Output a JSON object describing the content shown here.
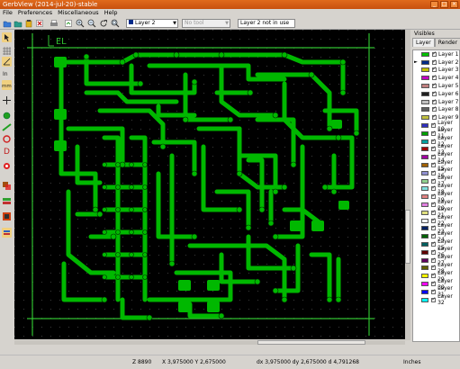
{
  "window": {
    "title": "GerbView (2014-jul-20)-stable"
  },
  "menu": [
    "File",
    "Preferences",
    "Miscellaneous",
    "Help"
  ],
  "toolbar": {
    "icons": [
      "open-gerber-icon",
      "open-drill-icon",
      "open-zip-icon",
      "erase-all-icon",
      "print-icon",
      "zoom-in-icon",
      "zoom-out-icon",
      "zoom-redraw-icon",
      "zoom-fit-icon"
    ],
    "layer_combo": "Layer 2",
    "tool_combo": "No tool",
    "layer_status": "Layer 2 not in use"
  },
  "left_tools": [
    "select-icon",
    "polar-coords-icon",
    "units-inches-icon",
    "units-mm-icon",
    "cursor-icon",
    "show-flashed-icon",
    "show-lines-icon",
    "show-polygons-icon",
    "show-dcodes-icon",
    "negative-objects-icon",
    "diff-mode-icon",
    "layers-manager-icon",
    "show-highlight-icon"
  ],
  "canvas": {
    "silk_text": "EL"
  },
  "panel": {
    "title": "Visibles",
    "tabs": [
      "Layer",
      "Render"
    ],
    "active_tab": "Layer",
    "layers": [
      {
        "name": "Layer 1",
        "color": "#00c000"
      },
      {
        "name": "Layer 2",
        "color": "#002a88",
        "current": true
      },
      {
        "name": "Layer 3",
        "color": "#c0c000"
      },
      {
        "name": "Layer 4",
        "color": "#c000c0"
      },
      {
        "name": "Layer 5",
        "color": "#c08080"
      },
      {
        "name": "Layer 6",
        "color": "#202020"
      },
      {
        "name": "Layer 7",
        "color": "#c0c0c0"
      },
      {
        "name": "Layer 8",
        "color": "#606060"
      },
      {
        "name": "Layer 9",
        "color": "#c0c040"
      },
      {
        "name": "Layer 10",
        "color": "#3030c0"
      },
      {
        "name": "Layer 11",
        "color": "#00a000"
      },
      {
        "name": "Layer 12",
        "color": "#00a0a0"
      },
      {
        "name": "Layer 13",
        "color": "#a00000"
      },
      {
        "name": "Layer 14",
        "color": "#a000a0"
      },
      {
        "name": "Layer 15",
        "color": "#a06000"
      },
      {
        "name": "Layer 16",
        "color": "#9090d0"
      },
      {
        "name": "Layer 17",
        "color": "#90d090"
      },
      {
        "name": "Layer 18",
        "color": "#80e0e0"
      },
      {
        "name": "Layer 19",
        "color": "#e08080"
      },
      {
        "name": "Layer 20",
        "color": "#e080e0"
      },
      {
        "name": "Layer 21",
        "color": "#e0e080"
      },
      {
        "name": "Layer 22",
        "color": "#ffffff"
      },
      {
        "name": "Layer 23",
        "color": "#002060"
      },
      {
        "name": "Layer 24",
        "color": "#006000"
      },
      {
        "name": "Layer 25",
        "color": "#006060"
      },
      {
        "name": "Layer 26",
        "color": "#600000"
      },
      {
        "name": "Layer 27",
        "color": "#600060"
      },
      {
        "name": "Layer 28",
        "color": "#606000"
      },
      {
        "name": "Layer 29",
        "color": "#ffff00"
      },
      {
        "name": "Layer 30",
        "color": "#ff00ff"
      },
      {
        "name": "Layer 31",
        "color": "#0000ff"
      },
      {
        "name": "Layer 32",
        "color": "#00ffff"
      }
    ]
  },
  "status": {
    "zoom": "Z 8890",
    "abs": "X 3,975000  Y 2,675000",
    "rel": "dx 3,975000  dy 2,675000  d 4,791268",
    "units": "Inches"
  },
  "colors": {
    "trace": "#00b800",
    "background": "#000000",
    "titlebar": "#d95f18"
  }
}
